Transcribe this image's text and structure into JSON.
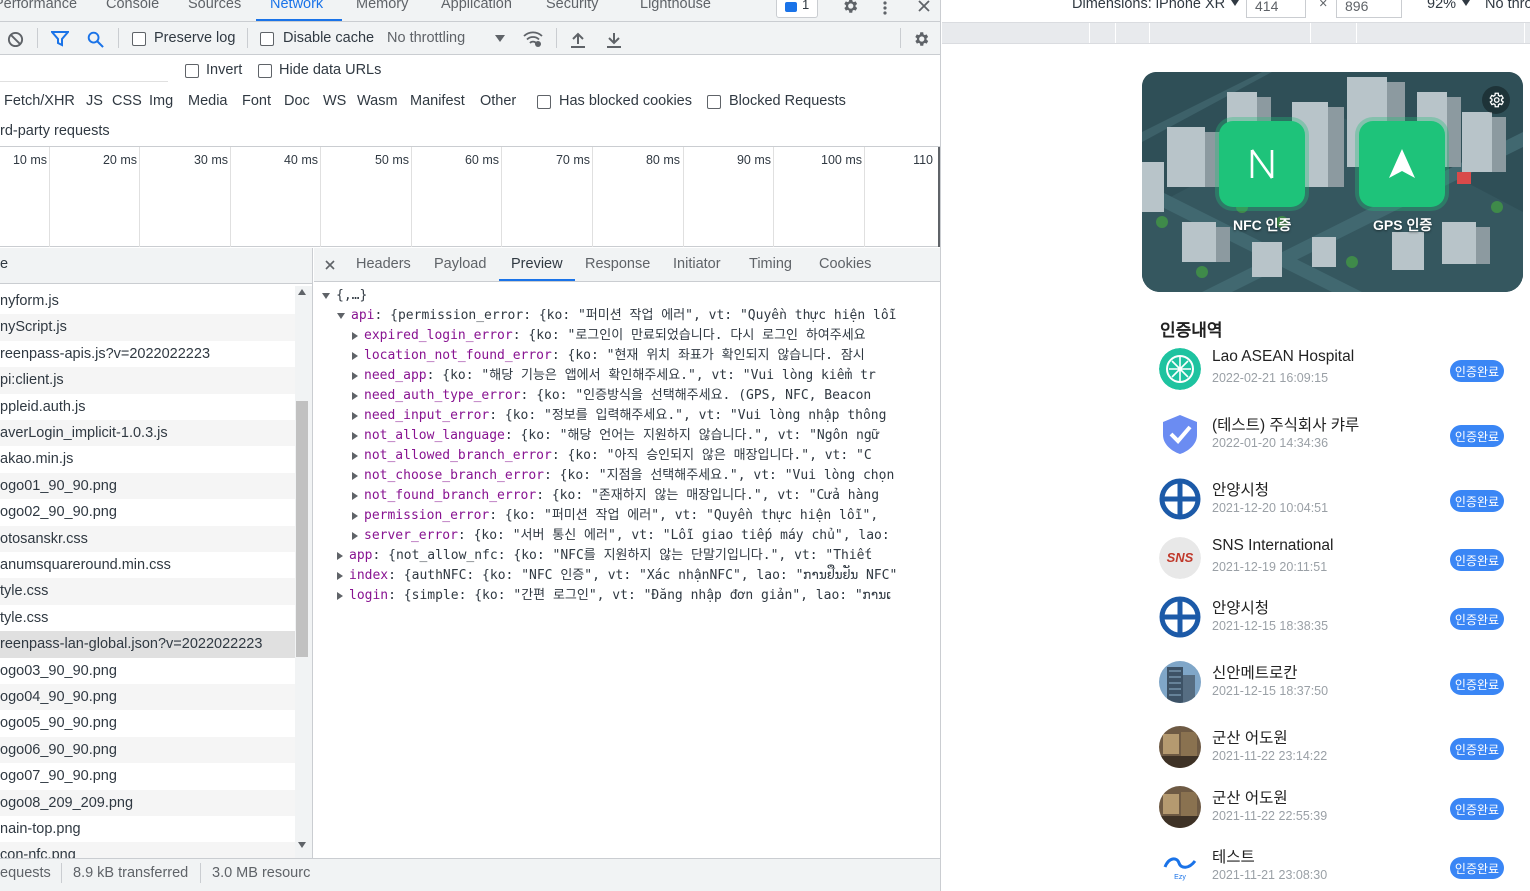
{
  "devtools": {
    "tabs": [
      "Performance",
      "Console",
      "Sources",
      "Network",
      "Memory",
      "Application",
      "Security",
      "Lighthouse"
    ],
    "active_tab": "Network",
    "issues_count": "1",
    "toolbar": {
      "preserve_log": "Preserve log",
      "disable_cache": "Disable cache",
      "throttling": "No throttling"
    },
    "filter": {
      "invert": "Invert",
      "hide_data_urls": "Hide data URLs"
    },
    "types": [
      "Fetch/XHR",
      "JS",
      "CSS",
      "Img",
      "Media",
      "Font",
      "Doc",
      "WS",
      "Wasm",
      "Manifest",
      "Other"
    ],
    "has_blocked_cookies": "Has blocked cookies",
    "blocked_requests": "Blocked Requests",
    "third_party": "rd-party requests",
    "overview_ticks": [
      "10 ms",
      "20 ms",
      "30 ms",
      "40 ms",
      "50 ms",
      "60 ms",
      "70 ms",
      "80 ms",
      "90 ms",
      "100 ms",
      "110"
    ],
    "list_header": "e",
    "requests": [
      "nyform.js",
      "nyScript.js",
      "reenpass-apis.js?v=2022022223",
      "pi:client.js",
      "ppleid.auth.js",
      "averLogin_implicit-1.0.3.js",
      "akao.min.js",
      "ogo01_90_90.png",
      "ogo02_90_90.png",
      "otosanskr.css",
      "anumsquareround.min.css",
      "tyle.css",
      "tyle.css",
      "reenpass-lan-global.json?v=2022022223",
      "ogo03_90_90.png",
      "ogo04_90_90.png",
      "ogo05_90_90.png",
      "ogo06_90_90.png",
      "ogo07_90_90.png",
      "ogo08_209_209.png",
      "nain-top.png",
      "con-nfc.png"
    ],
    "selected_index": 13,
    "status": {
      "requests": "equests",
      "transferred": "8.9 kB transferred",
      "resources": "3.0 MB resourc"
    },
    "preview_tabs": [
      "Headers",
      "Payload",
      "Preview",
      "Response",
      "Initiator",
      "Timing",
      "Cookies"
    ],
    "active_preview_tab": "Preview",
    "json_lines": [
      {
        "indent": 0,
        "arrow": "down",
        "key": "",
        "rest": "{,…}"
      },
      {
        "indent": 1,
        "arrow": "down",
        "key": "api",
        "rest": ": {permission_error: {ko: \"퍼미션 작업 에러\", vt: \"Quyền thực hiện lỗi"
      },
      {
        "indent": 2,
        "arrow": "right",
        "key": "expired_login_error",
        "rest": ": {ko: \"로그인이 만료되었습니다. 다시 로그인 하여주세요"
      },
      {
        "indent": 2,
        "arrow": "right",
        "key": "location_not_found_error",
        "rest": ": {ko: \"현재 위치 좌표가 확인되지 않습니다. 잠시"
      },
      {
        "indent": 2,
        "arrow": "right",
        "key": "need_app",
        "rest": ": {ko: \"해당 기능은 앱에서 확인해주세요.\", vt: \"Vui lòng kiểm tr"
      },
      {
        "indent": 2,
        "arrow": "right",
        "key": "need_auth_type_error",
        "rest": ": {ko: \"인증방식을 선택해주세요. (GPS, NFC, Beacon"
      },
      {
        "indent": 2,
        "arrow": "right",
        "key": "need_input_error",
        "rest": ": {ko: \"정보를 입력해주세요.\", vt: \"Vui lòng nhập thông"
      },
      {
        "indent": 2,
        "arrow": "right",
        "key": "not_allow_language",
        "rest": ": {ko: \"해당 언어는 지원하지 않습니다.\", vt: \"Ngôn ngữ"
      },
      {
        "indent": 2,
        "arrow": "right",
        "key": "not_allowed_branch_error",
        "rest": ": {ko: \"아직 승인되지 않은 매장입니다.\", vt: \"C"
      },
      {
        "indent": 2,
        "arrow": "right",
        "key": "not_choose_branch_error",
        "rest": ": {ko: \"지점을 선택해주세요.\", vt: \"Vui lòng chọn"
      },
      {
        "indent": 2,
        "arrow": "right",
        "key": "not_found_branch_error",
        "rest": ": {ko: \"존재하지 않는 매장입니다.\", vt: \"Cửa hàng"
      },
      {
        "indent": 2,
        "arrow": "right",
        "key": "permission_error",
        "rest": ": {ko: \"퍼미션 작업 에러\", vt: \"Quyền thực hiện lỗi\","
      },
      {
        "indent": 2,
        "arrow": "right",
        "key": "server_error",
        "rest": ": {ko: \"서버 통신 에러\", vt: \"Lỗi giao tiếp máy chủ\", lao:"
      },
      {
        "indent": 1,
        "arrow": "right",
        "key": "app",
        "rest": ": {not_allow_nfc: {ko: \"NFC를 지원하지 않는 단말기입니다.\", vt: \"Thiết"
      },
      {
        "indent": 1,
        "arrow": "right",
        "key": "index",
        "rest": ": {authNFC: {ko: \"NFC 인증\", vt: \"Xác nhậnNFC\", lao: \"ການຢືນຢັນ NFC\""
      },
      {
        "indent": 1,
        "arrow": "right",
        "key": "login",
        "rest": ": {simple: {ko: \"간편 로그인\", vt: \"Đăng nhập đơn giản\", lao: \"ການເ"
      }
    ]
  },
  "device": {
    "dimensions_label": "Dimensions: iPhone XR",
    "width": "414",
    "height": "896",
    "zoom": "92%",
    "throttle": "No thrott"
  },
  "app": {
    "nfc_label": "NFC 인증",
    "gps_label": "GPS 인증",
    "history_title": "인증내역",
    "badge": "인증완료",
    "items": [
      {
        "name": "Lao ASEAN Hospital",
        "date": "2022-02-21 16:09:15",
        "icon": "lao-asean-logo"
      },
      {
        "name": "(테스트) 주식회사 캬루",
        "date": "2022-01-20 14:34:36",
        "icon": "shield-check-logo"
      },
      {
        "name": "안양시청",
        "date": "2021-12-20 10:04:51",
        "icon": "anyang-logo"
      },
      {
        "name": "SNS International",
        "date": "2021-12-19 20:11:51",
        "icon": "sns-logo"
      },
      {
        "name": "안양시청",
        "date": "2021-12-15 18:38:35",
        "icon": "anyang-logo"
      },
      {
        "name": "신안메트로칸",
        "date": "2021-12-15 18:37:50",
        "icon": "building-photo"
      },
      {
        "name": "군산 어도원",
        "date": "2021-11-22 23:14:22",
        "icon": "restaurant-photo"
      },
      {
        "name": "군산 어도원",
        "date": "2021-11-22 22:55:39",
        "icon": "restaurant-photo"
      },
      {
        "name": "테스트",
        "date": "2021-11-21 23:08:30",
        "icon": "test-logo"
      }
    ]
  },
  "colors": {
    "accent": "#1a73e8",
    "key": "#881391",
    "tile_green": "#1ec37a",
    "badge_blue": "#3a86f5"
  }
}
